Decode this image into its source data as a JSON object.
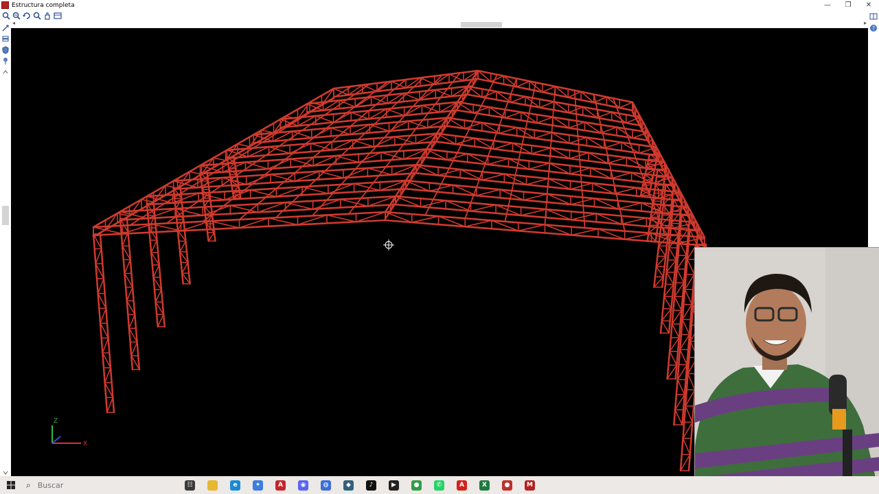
{
  "window": {
    "title": "Estructura completa",
    "minimize_label": "—",
    "restore_label": "❐",
    "close_label": "✕"
  },
  "toolbar": {
    "icons": [
      "zoom-window-icon",
      "zoom-all-icon",
      "rotate-icon",
      "zoom-icon",
      "pan-icon",
      "view-options-icon"
    ]
  },
  "viewport": {
    "background_color": "#000000",
    "structure_color": "#d03a2e",
    "axis_labels": {
      "z": "Z",
      "x": "X"
    }
  },
  "taskbar": {
    "search_placeholder": "Buscar",
    "apps": [
      {
        "name": "task-view",
        "glyph": "☷",
        "color": "#3a3a3a"
      },
      {
        "name": "file-explorer",
        "glyph": "",
        "color": "#e8b731"
      },
      {
        "name": "edge",
        "glyph": "e",
        "color": "#1a8ad4"
      },
      {
        "name": "app-bird",
        "glyph": "✦",
        "color": "#3b7de0"
      },
      {
        "name": "autocad",
        "glyph": "A",
        "color": "#c3262d"
      },
      {
        "name": "discord",
        "glyph": "◉",
        "color": "#5865f2"
      },
      {
        "name": "app-globe",
        "glyph": "◍",
        "color": "#3b6fd8"
      },
      {
        "name": "app-wing",
        "glyph": "◆",
        "color": "#33607f"
      },
      {
        "name": "tiktok",
        "glyph": "♪",
        "color": "#111111"
      },
      {
        "name": "media-player",
        "glyph": "▶",
        "color": "#222222"
      },
      {
        "name": "chrome",
        "glyph": "●",
        "color": "#2f9e44"
      },
      {
        "name": "whatsapp",
        "glyph": "✆",
        "color": "#25d366"
      },
      {
        "name": "acrobat",
        "glyph": "A",
        "color": "#d4231a"
      },
      {
        "name": "excel",
        "glyph": "X",
        "color": "#1f7a3f"
      },
      {
        "name": "app-red",
        "glyph": "●",
        "color": "#c0302a"
      },
      {
        "name": "structural-app",
        "glyph": "M",
        "color": "#b52222"
      }
    ]
  }
}
